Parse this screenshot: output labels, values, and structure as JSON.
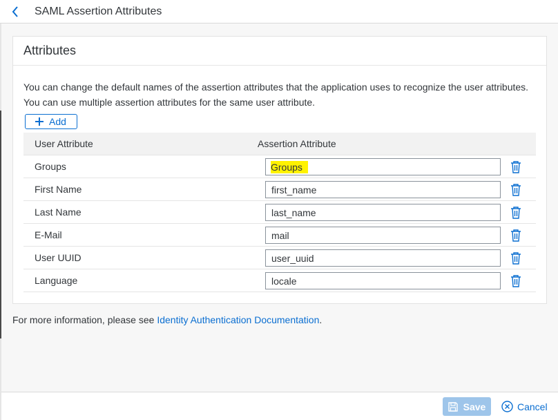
{
  "header": {
    "title": "SAML Assertion Attributes",
    "back_icon": "chevron-left-icon"
  },
  "panel": {
    "title": "Attributes",
    "description_line1": "You can change the default names of the assertion attributes that the application uses to recognize the user attributes.",
    "description_line2": "You can use multiple assertion attributes for the same user attribute.",
    "add_label": "Add"
  },
  "table": {
    "columns": [
      "User Attribute",
      "Assertion Attribute"
    ],
    "rows": [
      {
        "user_attribute": "Groups",
        "assertion_attribute": "Groups",
        "highlighted": true
      },
      {
        "user_attribute": "First Name",
        "assertion_attribute": "first_name"
      },
      {
        "user_attribute": "Last Name",
        "assertion_attribute": "last_name"
      },
      {
        "user_attribute": "E-Mail",
        "assertion_attribute": "mail"
      },
      {
        "user_attribute": "User UUID",
        "assertion_attribute": "user_uuid"
      },
      {
        "user_attribute": "Language",
        "assertion_attribute": "locale"
      }
    ]
  },
  "info": {
    "prefix": "For more information, please see ",
    "link": "Identity Authentication Documentation",
    "suffix": "."
  },
  "footer": {
    "save_label": "Save",
    "cancel_label": "Cancel"
  },
  "colors": {
    "accent": "#0a6ed1",
    "highlight": "#fff200",
    "save_disabled": "#9ec5ea"
  }
}
